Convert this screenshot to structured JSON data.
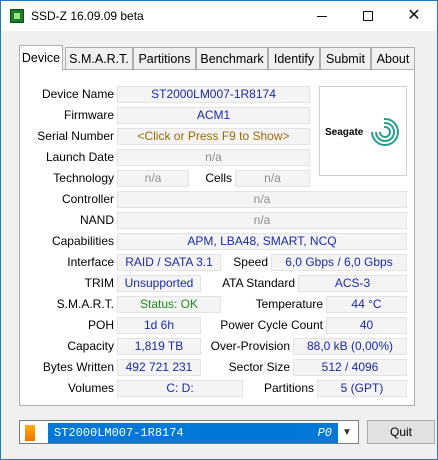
{
  "window": {
    "title": "SSD-Z 16.09.09 beta"
  },
  "tabs": [
    {
      "label": "Device"
    },
    {
      "label": "S.M.A.R.T."
    },
    {
      "label": "Partitions"
    },
    {
      "label": "Benchmark"
    },
    {
      "label": "Identify"
    },
    {
      "label": "Submit"
    },
    {
      "label": "About"
    }
  ],
  "device": {
    "device_name": {
      "label": "Device Name",
      "value": "ST2000LM007-1R8174"
    },
    "firmware": {
      "label": "Firmware",
      "value": "ACM1"
    },
    "serial": {
      "label": "Serial Number",
      "value": "<Click or Press F9 to Show>"
    },
    "launch_date": {
      "label": "Launch Date",
      "value": "n/a"
    },
    "technology": {
      "label": "Technology",
      "value": "n/a"
    },
    "cells": {
      "label": "Cells",
      "value": "n/a"
    },
    "controller": {
      "label": "Controller",
      "value": "n/a"
    },
    "nand": {
      "label": "NAND",
      "value": "n/a"
    },
    "capabilities": {
      "label": "Capabilities",
      "value": "APM, LBA48, SMART, NCQ"
    },
    "interface": {
      "label": "Interface",
      "value": "RAID / SATA 3.1"
    },
    "speed": {
      "label": "Speed",
      "value": "6,0 Gbps / 6,0 Gbps"
    },
    "trim": {
      "label": "TRIM",
      "value": "Unsupported"
    },
    "ata_standard": {
      "label": "ATA Standard",
      "value": "ACS-3"
    },
    "smart": {
      "label": "S.M.A.R.T.",
      "value": "Status: OK"
    },
    "temperature": {
      "label": "Temperature",
      "value": "44 °C"
    },
    "poh": {
      "label": "POH",
      "value": "1d 6h"
    },
    "power_cycle": {
      "label": "Power Cycle Count",
      "value": "40"
    },
    "capacity": {
      "label": "Capacity",
      "value": "1,819 TB"
    },
    "over_provision": {
      "label": "Over-Provision",
      "value": "88,0 kB (0,00%)"
    },
    "bytes_written": {
      "label": "Bytes Written",
      "value": "492 721 231"
    },
    "sector_size": {
      "label": "Sector Size",
      "value": "512 / 4096"
    },
    "volumes": {
      "label": "Volumes",
      "value": "C:  D:"
    },
    "partitions": {
      "label": "Partitions",
      "value": "5 (GPT)"
    },
    "logo": {
      "brand": "Seagate",
      "icon": "seagate-logo-icon"
    }
  },
  "footer": {
    "selected_device": "ST2000LM007-1R8174",
    "port": "P0",
    "quit_label": "Quit"
  }
}
